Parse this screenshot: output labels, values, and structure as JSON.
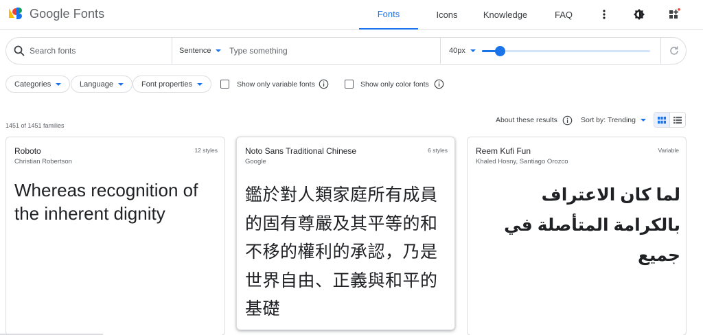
{
  "header": {
    "logo_text": "Google Fonts",
    "nav": {
      "fonts": "Fonts",
      "icons": "Icons",
      "knowledge": "Knowledge",
      "faq": "FAQ"
    }
  },
  "search": {
    "placeholder": "Search fonts",
    "preview_mode": "Sentence",
    "type_placeholder": "Type something",
    "size_value": "40px",
    "size_slider_fraction": 0.11
  },
  "filters": {
    "categories": "Categories",
    "language": "Language",
    "font_properties": "Font properties",
    "variable_label": "Show only variable fonts",
    "color_label": "Show only color fonts"
  },
  "results": {
    "count": "1451 of 1451 families",
    "about": "About these results",
    "sort": "Sort by: Trending"
  },
  "cards": [
    {
      "name": "Roboto",
      "author": "Christian Robertson",
      "meta": "12 styles",
      "sample": "Whereas recognition of the inherent dignity"
    },
    {
      "name": "Noto Sans Traditional Chinese",
      "author": "Google",
      "meta": "6 styles",
      "sample": "鑑於對人類家庭所有成員的固有尊嚴及其平等的和不移的權利的承認，乃是世界自由、正義與和平的基礎"
    },
    {
      "name": "Reem Kufi Fun",
      "author": "Khaled Hosny, Santiago Orozco",
      "meta": "Variable",
      "sample": "لما كان الاعتراف بالكرامة المتأصلة في جميع"
    }
  ],
  "colors": {
    "accent": "#1a73e8",
    "text": "#202124",
    "secondary": "#5f6368",
    "border": "#dadce0"
  }
}
